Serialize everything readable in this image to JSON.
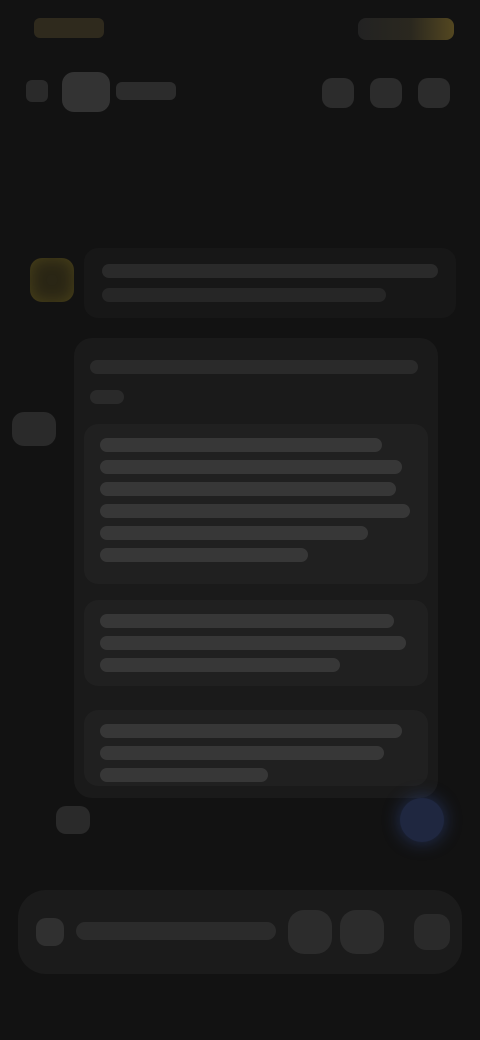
{
  "theme": {
    "background": "#121212",
    "surface": "#1a1a1a",
    "accent_gold": "#5b4d22",
    "accent_blue": "#1f2740"
  },
  "status_bar": {
    "left_icon": "time-icon",
    "right_icons": [
      "signal-icon",
      "battery-icon"
    ]
  },
  "app_bar": {
    "back_icon": "back-icon",
    "logo_icon": "app-logo-icon",
    "actions": [
      {
        "icon": "action-1-icon"
      },
      {
        "icon": "action-2-icon"
      },
      {
        "icon": "overflow-icon"
      }
    ]
  },
  "conversation": {
    "prompt": {
      "avatar_icon": "avatar-icon"
    },
    "response": {
      "left_icon": "assistant-icon",
      "blocks": [
        {
          "name": "response-block-1",
          "line_count": 6
        },
        {
          "name": "response-block-2",
          "line_count": 3
        },
        {
          "name": "response-block-3",
          "line_count": 3
        }
      ],
      "bottom_left_icon": "small-action-icon",
      "fab_icon": "fab-icon"
    }
  },
  "input_bar": {
    "left_icon": "add-icon",
    "actions": [
      {
        "icon": "mic-icon"
      },
      {
        "icon": "voice-icon"
      },
      {
        "icon": "send-icon"
      }
    ]
  }
}
